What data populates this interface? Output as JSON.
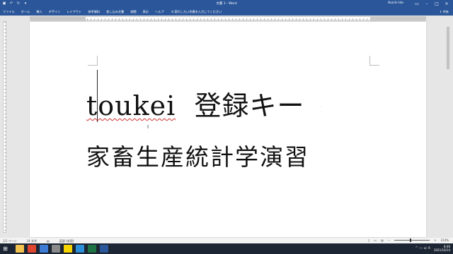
{
  "window": {
    "title": "文書 1 - Word",
    "user": "Koichi Ide",
    "qat_icons": [
      "save-icon",
      "undo-icon",
      "redo-icon",
      "customize-icon"
    ]
  },
  "ribbon": {
    "tabs": [
      "ファイル",
      "ホーム",
      "挿入",
      "デザイン",
      "レイアウト",
      "参考資料",
      "差し込み文書",
      "校閲",
      "表示",
      "ヘルプ"
    ],
    "tell_me": "実行したい作業を入力してください",
    "share": "共有"
  },
  "document": {
    "line1_word": "toukei",
    "line1_rest": "登録キー",
    "line2": "家畜生産統計学演習"
  },
  "statusbar": {
    "page": "1/1 ページ",
    "words": "14 文字",
    "language": "英語 (米国)",
    "zoom": "214%"
  },
  "taskbar": {
    "time": "8:46",
    "date": "2021/10/14",
    "icons": [
      {
        "name": "explorer-icon",
        "color": "#f2c14e"
      },
      {
        "name": "chrome-icon",
        "color": "#e0452f"
      },
      {
        "name": "photos-icon",
        "color": "#3d7bd4"
      },
      {
        "name": "settings-icon",
        "color": "#8a8a8a"
      },
      {
        "name": "messenger-icon",
        "color": "#f5d400"
      },
      {
        "name": "mail-icon",
        "color": "#2c8fd8"
      },
      {
        "name": "excel-icon",
        "color": "#1f7244"
      },
      {
        "name": "word-icon",
        "color": "#2b579a"
      }
    ]
  },
  "colors": {
    "accent": "#2b579a",
    "spellcheck": "#d03030"
  }
}
